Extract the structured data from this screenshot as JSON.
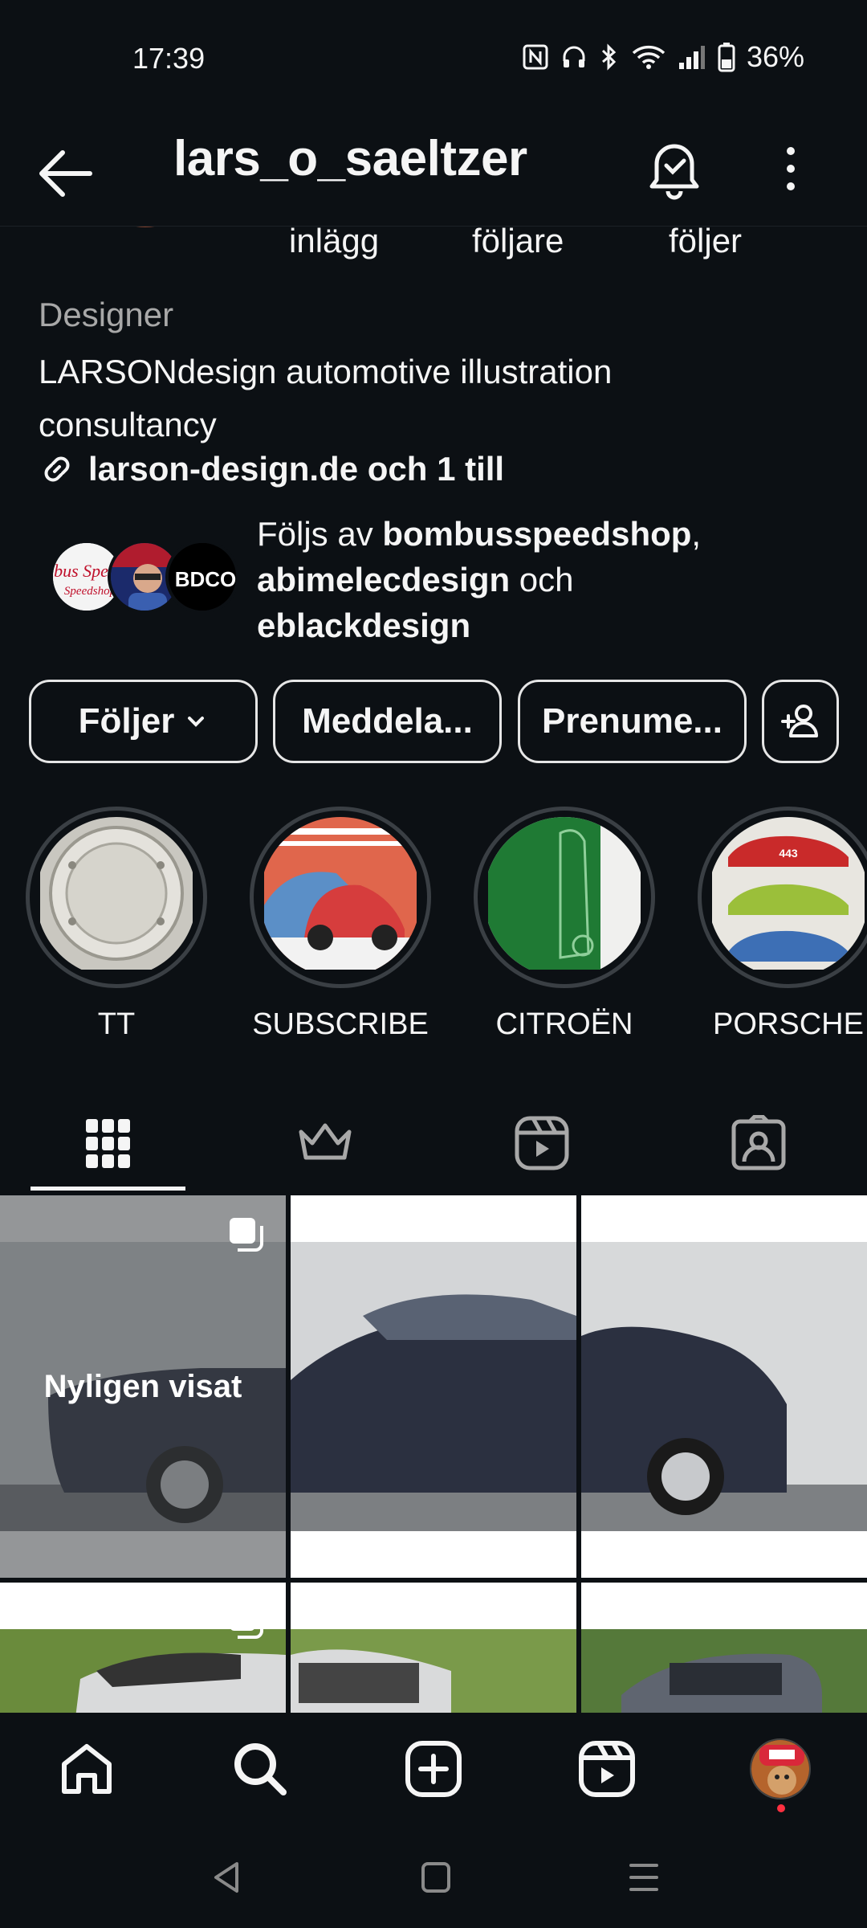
{
  "status_bar": {
    "time": "17:39",
    "battery": "36%",
    "icons": [
      "nfc-icon",
      "headphones-icon",
      "bluetooth-icon",
      "wifi-icon",
      "signal-icon",
      "battery-icon"
    ]
  },
  "header": {
    "username": "lars_o_saeltzer",
    "icons": [
      "back-arrow-icon",
      "bell-icon",
      "more-vertical-icon"
    ]
  },
  "profile": {
    "stats_labels": {
      "posts": "inlägg",
      "followers": "följare",
      "following": "följer"
    },
    "category": "Designer",
    "bio_line1": "LARSONdesign automotive illustration",
    "bio_line2": "consultancy",
    "link": "larson-design.de och 1 till"
  },
  "followed_by": {
    "prefix": "Följs av ",
    "user1": "bombusspeedshop",
    "sep": ",",
    "user2": "abimelecdesign",
    "and": " och",
    "user3": "eblackdesign",
    "avatar_labels": [
      "Bombus Speedshop",
      "BDCO"
    ]
  },
  "buttons": {
    "follow": "Följer",
    "message": "Meddela...",
    "subscribe": "Prenume..."
  },
  "highlights": [
    {
      "label": "TT"
    },
    {
      "label": "SUBSCRIBE"
    },
    {
      "label": "CITROËN"
    },
    {
      "label": "PORSCHE"
    }
  ],
  "porsche_plate": "443",
  "tabs": [
    "grid-icon",
    "crown-icon",
    "reels-icon",
    "tagged-icon"
  ],
  "grid": {
    "overlay_text": "Nyligen visat"
  },
  "bottom_nav": [
    "home-icon",
    "search-icon",
    "create-icon",
    "reels-icon",
    "profile-avatar"
  ],
  "colors": {
    "background": "#0c1014",
    "text": "#f5f5f5",
    "secondary_text": "#a8a8a8",
    "notification_dot": "#ff3040"
  }
}
